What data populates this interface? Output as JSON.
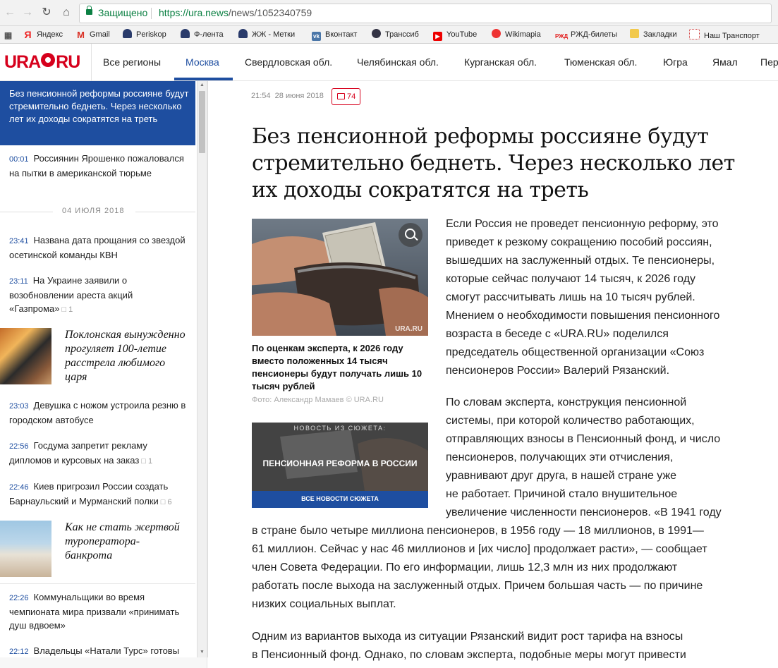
{
  "browser": {
    "secure_label": "Защищено",
    "url_host": "https://ura.news",
    "url_path": "/news/1052340759"
  },
  "bookmarks": [
    {
      "label": "",
      "icon": "apps-icon"
    },
    {
      "label": "Яндекс",
      "icon": "yandex-icon"
    },
    {
      "label": "Gmail",
      "icon": "gmail-icon"
    },
    {
      "label": "Periskop",
      "icon": "user-icon"
    },
    {
      "label": "Ф-лента",
      "icon": "user-icon"
    },
    {
      "label": "ЖЖ - Метки",
      "icon": "user-icon"
    },
    {
      "label": "Вконтакт",
      "icon": "vk-icon"
    },
    {
      "label": "Транссиб",
      "icon": "train-icon"
    },
    {
      "label": "YouTube",
      "icon": "youtube-icon"
    },
    {
      "label": "Wikimapia",
      "icon": "wikimapia-icon"
    },
    {
      "label": "РЖД-билеты",
      "icon": "rzd-icon"
    },
    {
      "label": "Закладки",
      "icon": "folder-icon"
    },
    {
      "label": "Наш Транспорт",
      "icon": "transport-icon"
    }
  ],
  "site": {
    "logo": "URA.RU",
    "regions": [
      "Все регионы",
      "Москва",
      "Свердловская обл.",
      "Челябинская обл.",
      "Курганская обл.",
      "Тюменская обл.",
      "Югра",
      "Ямал",
      "Пер"
    ],
    "active_region": "Москва"
  },
  "sidebar": {
    "active_item": "Без пенсионной реформы россияне будут стремительно беднеть. Через несколько лет их доходы сократятся на треть",
    "items": [
      {
        "time": "00:01",
        "title": "Россиянин Ярошенко пожаловался на пытки в американской тюрьме",
        "comments": ""
      },
      {
        "time": "23:41",
        "title": "Названа дата прощания со звездой осетинской команды КВН",
        "comments": ""
      },
      {
        "time": "23:11",
        "title": "На Украине заявили о возобновлении ареста акций «Газпрома»",
        "comments": "1"
      },
      {
        "time": "23:03",
        "title": "Девушка с ножом устроила резню в городском автобусе",
        "comments": ""
      },
      {
        "time": "22:56",
        "title": "Госдума запретит рекламу дипломов и курсовых на заказ",
        "comments": "1"
      },
      {
        "time": "22:46",
        "title": "Киев пригрозил России создать Барнаульский и Мурманский полки",
        "comments": "6"
      },
      {
        "time": "22:26",
        "title": "Коммунальщики во время чемпионата мира призвали «принимать душ вдвоем»",
        "comments": ""
      },
      {
        "time": "22:12",
        "title": "Владельцы «Натали Турс» готовы",
        "comments": ""
      }
    ],
    "date_divider": "04 ИЮЛЯ 2018",
    "features": [
      {
        "title": "Поклонская вынужденно прогуляет 100-летие расстрела любимого царя"
      },
      {
        "title": "Как не стать жертвой туроператора-банкрота"
      }
    ]
  },
  "article": {
    "time": "21:54",
    "date": "28 июня 2018",
    "comments": "74",
    "headline": "Без пенсионной реформы россияне будут стремительно беднеть. Через несколько лет их доходы сократятся на треть",
    "photo_watermark": "URA.RU",
    "photo_caption": "По оценкам эксперта, к 2026 году вместо положенных 14 тысяч пенсионеры будут получать лишь 10 тысяч рублей",
    "photo_credit": "Фото: Александр Мамаев © URA.RU",
    "story": {
      "kicker": "НОВОСТЬ ИЗ СЮЖЕТА:",
      "title": "ПЕНСИОННАЯ РЕФОРМА В РОССИИ",
      "link": "ВСЕ НОВОСТИ СЮЖЕТА"
    },
    "p1_lines": [
      "Если Россия не проведет пенсионную реформу, это",
      "приведет к резкому сокращению пособий россиян,",
      "вышедших на заслуженный отдых. Те пенсионеры,",
      "которые сейчас получают 14 тысяч, к 2026 году",
      "смогут рассчитывать лишь на 10 тысяч рублей.",
      "Мнением о необходимости повышения пенсионного",
      "возраста в беседе с «URA.RU» поделился",
      "председатель общественной организации «Союз",
      "пенсионеров России» Валерий Рязанский."
    ],
    "p2_lines": [
      "По словам эксперта, конструкция пенсионной",
      "системы, при которой количество работающих,",
      "отправляющих взносы в Пенсионный фонд, и число",
      "пенсионеров, получающих эти отчисления,",
      "уравнивают друг друга, в нашей стране уже",
      "не работает. Причиной стало внушительное",
      "увеличение численности пенсионеров. «В 1941 году"
    ],
    "p2_full_lines": [
      "в стране было четыре миллиона пенсионеров, в 1956 году — 18 миллионов, в 1991—",
      "61 миллион. Сейчас у нас 46 миллионов и [их число] продолжает расти», — сообщает",
      "член Совета Федерации. По его информации, лишь 12,3 млн из них продолжают",
      "работать после выхода на заслуженный отдых. Причем большая часть — по причине",
      "низких социальных выплат."
    ],
    "p3_lines": [
      "Одним из вариантов выхода из ситуации Рязанский видит рост тарифа на взносы",
      "в Пенсионный фонд. Однако, по словам эксперта, подобные меры могут привести"
    ]
  }
}
